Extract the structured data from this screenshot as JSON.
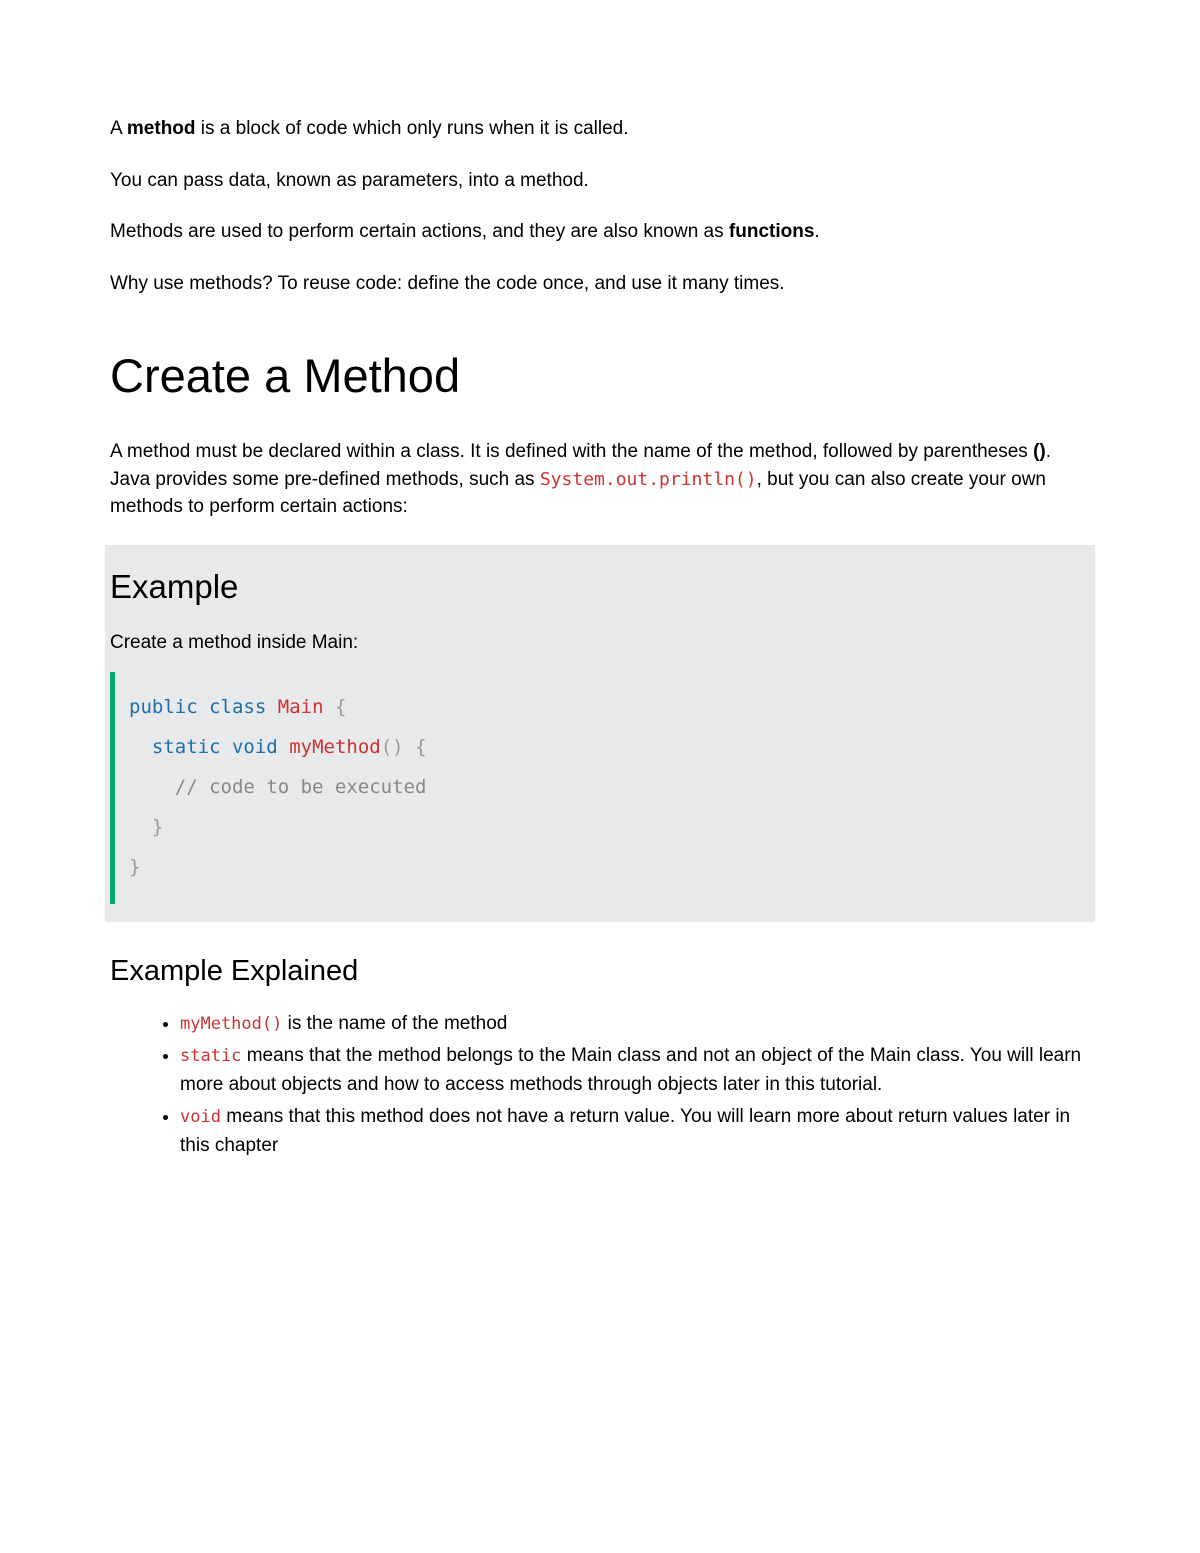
{
  "intro": {
    "p1_a": "A ",
    "p1_b": "method",
    "p1_c": " is a block of code which only runs when it is called.",
    "p2": "You can pass data, known as parameters, into a method.",
    "p3_a": "Methods are used to perform certain actions, and they are also known as ",
    "p3_b": "functions",
    "p3_c": ".",
    "p4": "Why use methods? To reuse code: define the code once, and use it many times."
  },
  "h1": "Create a Method",
  "create": {
    "p_a": "A method must be declared within a class. It is defined with the name of the method, followed by parentheses ",
    "p_b": "()",
    "p_c": ". Java provides some pre-defined methods, such as ",
    "p_code": "System.out.println()",
    "p_d": ", but you can also create your own methods to perform certain actions:"
  },
  "example": {
    "heading": "Example",
    "intro": "Create a method inside Main:",
    "code": {
      "l1_public": "public",
      "l1_class": "class",
      "l1_main": "Main",
      "l1_brace": "{",
      "l2_static": "static",
      "l2_void": "void",
      "l2_myMethod": "myMethod",
      "l2_paren": "()",
      "l2_brace": "{",
      "l3_comment": "// code to be executed",
      "l4_brace": "}",
      "l5_brace": "}"
    }
  },
  "explained": {
    "heading": "Example Explained",
    "li1_code": "myMethod()",
    "li1_text": " is the name of the method",
    "li2_code": "static",
    "li2_text": " means that the method belongs to the Main class and not an object of the Main class. You will learn more about objects and how to access methods through objects later in this tutorial.",
    "li3_code": "void",
    "li3_text": " means that this method does not have a return value. You will learn more about return values later in this chapter"
  }
}
